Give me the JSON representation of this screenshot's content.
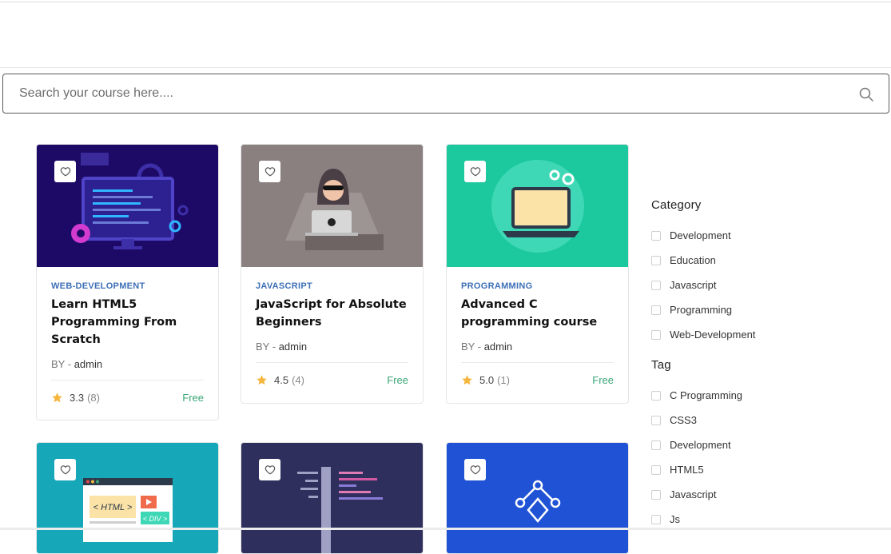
{
  "search": {
    "placeholder": "Search your course here...."
  },
  "courses": [
    {
      "category": "WEB-DEVELOPMENT",
      "title": "Learn HTML5 Programming From Scratch",
      "by_label": "BY -",
      "author": "admin",
      "rating": "3.3",
      "count": "(8)",
      "price": "Free"
    },
    {
      "category": "JAVASCRIPT",
      "title": "JavaScript for Absolute Beginners",
      "by_label": "BY -",
      "author": "admin",
      "rating": "4.5",
      "count": "(4)",
      "price": "Free"
    },
    {
      "category": "PROGRAMMING",
      "title": "Advanced C programming course",
      "by_label": "BY -",
      "author": "admin",
      "rating": "5.0",
      "count": "(1)",
      "price": "Free"
    }
  ],
  "thumbnail_labels": {
    "html_tag": "< HTML >",
    "div_tag": "< DIV >"
  },
  "sidebar": {
    "category_title": "Category",
    "categories": [
      "Development",
      "Education",
      "Javascript",
      "Programming",
      "Web-Development"
    ],
    "tag_title": "Tag",
    "tags": [
      "C Programming",
      "CSS3",
      "Development",
      "HTML5",
      "Javascript",
      "Js"
    ]
  },
  "colors": {
    "accent_blue": "#3d6fb6",
    "price_green": "#3aa676",
    "star_yellow": "#f4b63f"
  },
  "icons": {
    "search": "search-icon",
    "wishlist": "heart-outline-icon",
    "rating": "star-icon"
  }
}
